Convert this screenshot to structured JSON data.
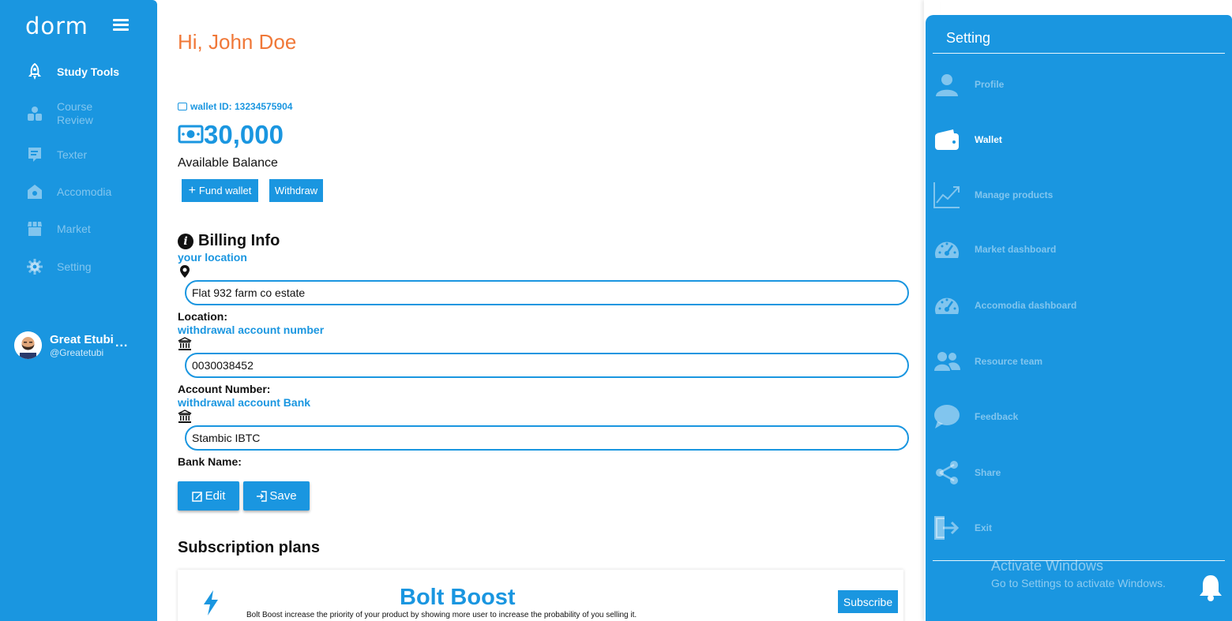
{
  "app": {
    "logo": "dorm"
  },
  "sidebar": {
    "items": [
      {
        "label": "Study Tools",
        "icon": "rocket-icon",
        "active": true
      },
      {
        "label": "Course Review",
        "icon": "people-icon",
        "active": false
      },
      {
        "label": "Texter",
        "icon": "chat-icon",
        "active": false
      },
      {
        "label": "Accomodia",
        "icon": "home-icon",
        "active": false
      },
      {
        "label": "Market",
        "icon": "store-icon",
        "active": false
      },
      {
        "label": "Setting",
        "icon": "gear-icon",
        "active": false
      }
    ],
    "user": {
      "name": "Great Etubi",
      "handle": "@Greatetubi",
      "more": "..."
    }
  },
  "main": {
    "greeting": "Hi, John Doe",
    "wallet_id": "wallet ID: 13234575904",
    "balance": "30,000",
    "balance_label": "Available Balance",
    "fund_button": "Fund wallet",
    "withdraw_button": "Withdraw",
    "billing": {
      "title": "Billing Info",
      "location_hint": "your location",
      "location_value": "Flat 932 farm co estate",
      "location_label": "Location:",
      "account_hint": "withdrawal account number",
      "account_value": "0030038452",
      "account_label": "Account Number:",
      "bank_hint": "withdrawal account Bank",
      "bank_value": "Stambic IBTC",
      "bank_label": "Bank Name:",
      "edit_button": "Edit",
      "save_button": "Save"
    },
    "subscription": {
      "title": "Subscription plans",
      "plans": [
        {
          "name": "Bolt Boost",
          "description": "Bolt Boost increase the priority of your product by showing more user to increase the probability of you selling it.",
          "button": "Subscribe",
          "icon": "bolt-icon"
        }
      ]
    }
  },
  "settings_panel": {
    "title": "Setting",
    "items": [
      {
        "label": "Profile",
        "icon": "user-icon",
        "active": false
      },
      {
        "label": "Wallet",
        "icon": "wallet-icon",
        "active": true
      },
      {
        "label": "Manage products",
        "icon": "chart-line-icon",
        "active": false
      },
      {
        "label": "Market dashboard",
        "icon": "gauge-icon",
        "active": false
      },
      {
        "label": "Accomodia dashboard",
        "icon": "gauge-icon",
        "active": false
      },
      {
        "label": "Resource team",
        "icon": "users-icon",
        "active": false
      },
      {
        "label": "Feedback",
        "icon": "speech-bubble-icon",
        "active": false
      },
      {
        "label": "Share",
        "icon": "share-icon",
        "active": false
      },
      {
        "label": "Exit",
        "icon": "exit-icon",
        "active": false
      }
    ]
  },
  "os_overlay": {
    "activate_title": "Activate Windows",
    "activate_subtitle": "Go to Settings to activate Windows."
  },
  "colors": {
    "primary": "#1a96e0",
    "greeting": "#f07838"
  }
}
